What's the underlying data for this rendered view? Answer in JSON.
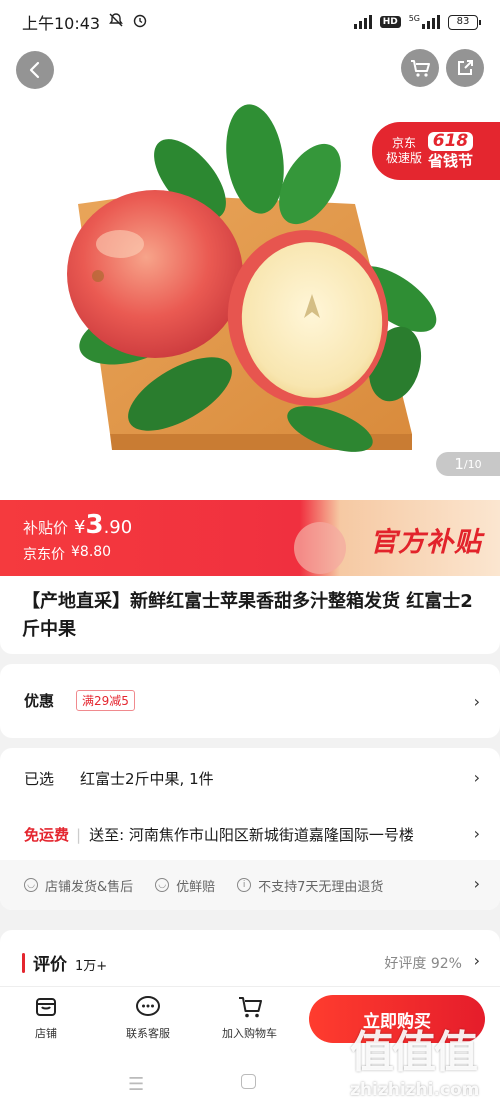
{
  "status_bar": {
    "time": "上午10:43",
    "network": "HD",
    "net_gen": "5G",
    "battery": "83"
  },
  "gallery": {
    "promo_brand": "京东\n极速版",
    "promo_number": "618",
    "promo_text": "省钱节",
    "counter_current": "1",
    "counter_total": "/10",
    "image_subject": "apples-on-cutting-board"
  },
  "price": {
    "subsidy_label": "补贴价",
    "subsidy_currency": "¥",
    "subsidy_int": "3",
    "subsidy_dec": ".90",
    "jd_label": "京东价",
    "jd_price": "¥8.80",
    "official_label": "官方补贴"
  },
  "product": {
    "title": "【产地直采】新鲜红富士苹果香甜多汁整箱发货 红富士2斤中果"
  },
  "discount": {
    "label": "优惠",
    "coupon": "满29减5"
  },
  "selection": {
    "selected_label": "已选",
    "selected_value": "红富士2斤中果, 1件",
    "ship_label": "免运费",
    "ship_to": "送至: 河南焦作市山阳区新城街道嘉隆国际一号楼"
  },
  "services": [
    "店铺发货&售后",
    "优鲜赔",
    "不支持7天无理由退货"
  ],
  "review": {
    "title": "评价",
    "count": "1万+",
    "rate": "好评度 92%"
  },
  "actions": {
    "store": "店铺",
    "service": "联系客服",
    "add_cart": "加入购物车",
    "buy_now": "立即购买"
  },
  "watermark": {
    "logo": "值值值",
    "site": "zhizhizhi.com"
  },
  "colors": {
    "accent": "#e4262f",
    "price_bar": "#f53a3e",
    "background": "#f2f2f2"
  }
}
